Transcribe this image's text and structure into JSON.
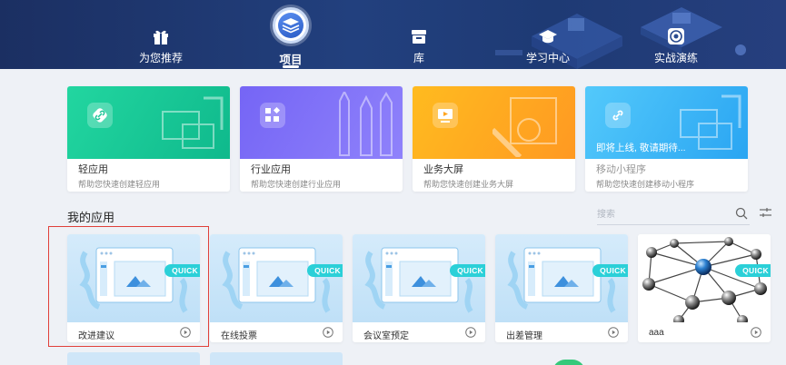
{
  "nav": {
    "items": [
      {
        "label": "为您推荐",
        "icon": "gift-icon",
        "active": false
      },
      {
        "label": "项目",
        "icon": "layers-icon",
        "active": true
      },
      {
        "label": "库",
        "icon": "archive-icon",
        "active": false
      },
      {
        "label": "学习中心",
        "icon": "graduation-cap-icon",
        "active": false
      },
      {
        "label": "实战演练",
        "icon": "target-icon",
        "active": false
      }
    ]
  },
  "templates": [
    {
      "title": "轻应用",
      "desc": "帮助您快速创建轻应用",
      "icon": "link-icon",
      "color_from": "#1fd39a",
      "color_to": "#10b98a"
    },
    {
      "title": "行业应用",
      "desc": "帮助您快速创建行业应用",
      "icon": "grid-icon",
      "color_from": "#7b6cf6",
      "color_to": "#8d7ef9"
    },
    {
      "title": "业务大屏",
      "desc": "帮助您快速创建业务大屏",
      "icon": "screen-icon",
      "color_from": "#ffb21a",
      "color_to": "#ff9a24"
    },
    {
      "title": "移动小程序",
      "desc": "帮助您快速创建移动小程序",
      "overlay": "即将上线, 敬请期待...",
      "icon": "link-icon",
      "color_from": "#49c4fb",
      "color_to": "#2ea8f3"
    }
  ],
  "my_apps": {
    "title": "我的应用",
    "search_placeholder": "搜索",
    "apps": [
      {
        "name": "改进建议",
        "badge": "QUICK"
      },
      {
        "name": "在线投票",
        "badge": "QUICK"
      },
      {
        "name": "会议室预定",
        "badge": "QUICK"
      },
      {
        "name": "出差管理",
        "badge": "QUICK"
      },
      {
        "name": "aaa",
        "badge": "QUICK"
      }
    ]
  },
  "colors": {
    "selection": "#e0403a",
    "quick_badge": "#2bd0d8",
    "nav_bg": "#1e3a74"
  }
}
